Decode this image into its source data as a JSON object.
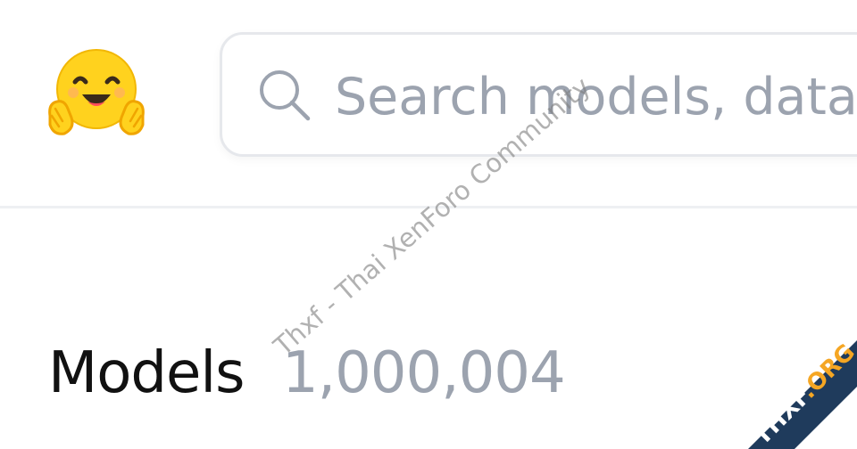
{
  "header": {
    "logo": {
      "icon": "hugging-face-emoji-icon",
      "alt": "Hugging Face"
    },
    "search": {
      "icon": "search-icon",
      "placeholder": "Search models, datasets, users..."
    }
  },
  "main": {
    "heading": "Models",
    "count": "1,000,004"
  },
  "overlay": {
    "watermark_text": "Thxf - Thai XenForo Community",
    "badge_prefix": "THXF",
    "badge_suffix": ".ORG"
  },
  "colors": {
    "accent_yellow": "#ffd21e",
    "muted_text": "#9ca3af",
    "badge_blue": "#1f3b5c",
    "badge_orange": "#f5a623"
  }
}
